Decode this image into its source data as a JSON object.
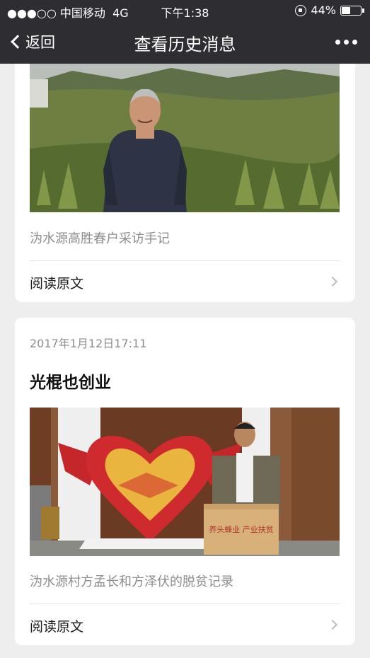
{
  "status_bar": {
    "carrier": "●●●○○ 中国移动",
    "network": "4G",
    "time": "下午1:38",
    "battery_text": "44%",
    "battery_level": 0.44
  },
  "nav": {
    "back_label": "返回",
    "title": "查看历史消息"
  },
  "articles": [
    {
      "digest": "沩水源高胜春户采访手记",
      "read_more": "阅读原文"
    },
    {
      "date": "2017年1月12日17:11",
      "title": "光棍也创业",
      "digest": "沩水源村方孟长和方泽伏的脱贫记录",
      "read_more": "阅读原文",
      "box_text": "养头蜂业 产业扶贫"
    }
  ]
}
